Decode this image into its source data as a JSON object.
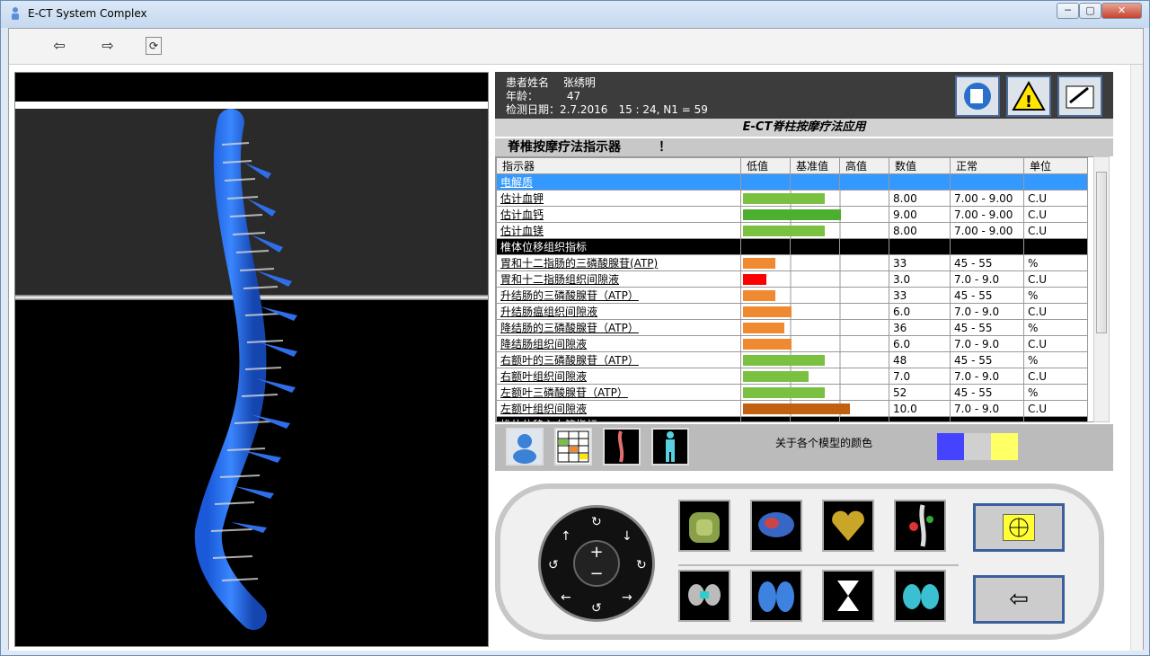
{
  "window": {
    "title": "E-CT System Complex"
  },
  "toolbar": {
    "back_icon": "⇦",
    "forward_icon": "⇨",
    "refresh_icon": "⟳"
  },
  "patient": {
    "name_label": "患者姓名",
    "name": "张绣明",
    "age_label": "年龄：",
    "age": "47",
    "date_line": "检测日期：2.7.2016　15 : 24, N1 = 59"
  },
  "subtitle": "E-CT脊柱按摩疗法应用",
  "indicator_title": "脊椎按摩疗法指示器　　　！",
  "table": {
    "headers": [
      "指示器",
      "低值",
      "基准值",
      "高值",
      "数值",
      "正常",
      "单位"
    ],
    "rows": [
      {
        "type": "group-blue",
        "name": "电解质"
      },
      {
        "type": "row",
        "name": "估计血钾",
        "value": "8.00",
        "normal": "7.00 - 9.00",
        "unit": "C.U",
        "bar_start": 0.0,
        "bar_end": 0.55,
        "color": "#7ac142"
      },
      {
        "type": "row",
        "name": "估计血钙",
        "value": "9.00",
        "normal": "7.00 - 9.00",
        "unit": "C.U",
        "bar_start": 0.0,
        "bar_end": 0.66,
        "color": "#4caf30"
      },
      {
        "type": "row",
        "name": "估计血镁",
        "value": "8.00",
        "normal": "7.00 - 9.00",
        "unit": "C.U",
        "bar_start": 0.0,
        "bar_end": 0.55,
        "color": "#7ac142"
      },
      {
        "type": "group-black",
        "name": "椎体位移组织指标"
      },
      {
        "type": "row",
        "name": "胃和十二指肠的三磷酸腺苷(ATP)",
        "value": "33",
        "normal": "45 - 55",
        "unit": "%",
        "bar_start": 0.0,
        "bar_end": 0.22,
        "color": "#f08a30"
      },
      {
        "type": "row",
        "name": "胃和十二指肠组织间隙液",
        "value": "3.0",
        "normal": "7.0 - 9.0",
        "unit": "C.U",
        "bar_start": 0.0,
        "bar_end": 0.16,
        "color": "#ff0000"
      },
      {
        "type": "row",
        "name": "升结肠的三磷酸腺苷（ATP）",
        "value": "33",
        "normal": "45 - 55",
        "unit": "%",
        "bar_start": 0.0,
        "bar_end": 0.22,
        "color": "#f08a30"
      },
      {
        "type": "row",
        "name": "升结肠瘟组织间隙液",
        "value": "6.0",
        "normal": "7.0 - 9.0",
        "unit": "C.U",
        "bar_start": 0.0,
        "bar_end": 0.33,
        "color": "#f08a30"
      },
      {
        "type": "row",
        "name": "降结肠的三磷酸腺苷（ATP）",
        "value": "36",
        "normal": "45 - 55",
        "unit": "%",
        "bar_start": 0.0,
        "bar_end": 0.28,
        "color": "#f08a30"
      },
      {
        "type": "row",
        "name": "降结肠组织间隙液",
        "value": "6.0",
        "normal": "7.0 - 9.0",
        "unit": "C.U",
        "bar_start": 0.0,
        "bar_end": 0.33,
        "color": "#f08a30"
      },
      {
        "type": "row",
        "name": "右额叶的三磷酸腺苷（ATP）",
        "value": "48",
        "normal": "45 - 55",
        "unit": "%",
        "bar_start": 0.0,
        "bar_end": 0.55,
        "color": "#7ac142"
      },
      {
        "type": "row",
        "name": "右额叶组织间隙液",
        "value": "7.0",
        "normal": "7.0 - 9.0",
        "unit": "C.U",
        "bar_start": 0.0,
        "bar_end": 0.44,
        "color": "#7ac142"
      },
      {
        "type": "row",
        "name": "左额叶三磷酸腺苷（ATP）",
        "value": "52",
        "normal": "45 - 55",
        "unit": "%",
        "bar_start": 0.0,
        "bar_end": 0.55,
        "color": "#7ac142"
      },
      {
        "type": "row",
        "name": "左额叶组织间隙液",
        "value": "10.0",
        "normal": "7.0 - 9.0",
        "unit": "C.U",
        "bar_start": 0.0,
        "bar_end": 0.72,
        "color": "#c06010"
      },
      {
        "type": "group-black",
        "name": "椎体位移心血管指标"
      }
    ]
  },
  "bottom_strip": {
    "color_label": "关于各个模型的颜色",
    "swatches": [
      "#4444ff",
      "#d0d0d0",
      "#ffff66"
    ]
  }
}
